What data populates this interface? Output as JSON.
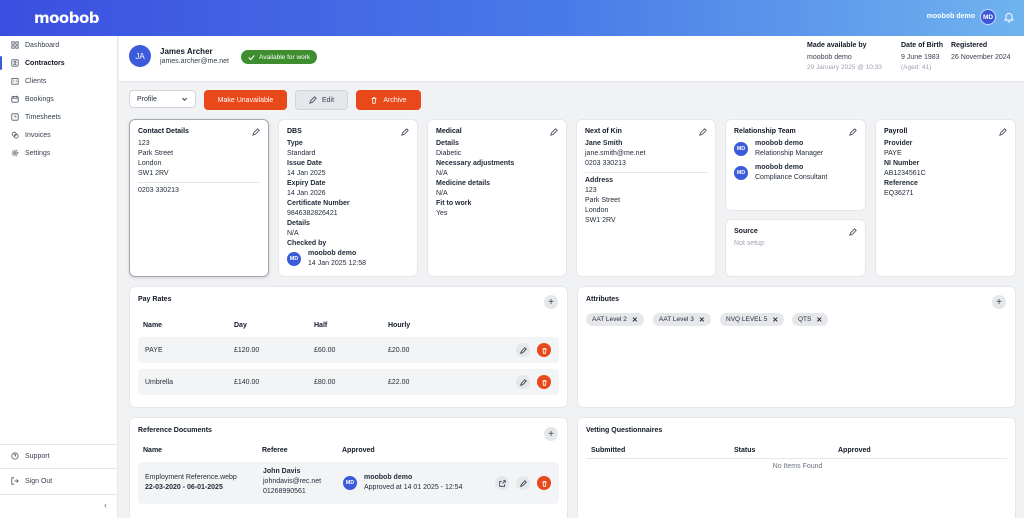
{
  "app": {
    "logo": "moobob",
    "user_name": "moobob demo",
    "user_initials": "MD"
  },
  "sidebar": {
    "items": [
      {
        "label": "Dashboard",
        "icon": "grid-icon"
      },
      {
        "label": "Contractors",
        "icon": "user-id-icon",
        "active": true
      },
      {
        "label": "Clients",
        "icon": "building-icon"
      },
      {
        "label": "Bookings",
        "icon": "calendar-icon"
      },
      {
        "label": "Timesheets",
        "icon": "clock-icon"
      },
      {
        "label": "Invoices",
        "icon": "coins-icon"
      },
      {
        "label": "Settings",
        "icon": "gear-icon"
      }
    ],
    "support": "Support",
    "sign_out": "Sign Out",
    "collapse": "‹"
  },
  "profile": {
    "initials": "JA",
    "name": "James Archer",
    "email": "james.archer@me.net",
    "status": "Available for work",
    "made_available_label": "Made available by",
    "made_available_by": "moobob demo",
    "made_available_at": "29 January 2025 @ 10:33",
    "dob_label": "Date of Birth",
    "dob": "9 June 1983",
    "age": "(Aged: 41)",
    "registered_label": "Registered",
    "registered": "26 November 2024"
  },
  "actions": {
    "select_value": "Profile",
    "make_unavailable": "Make Unavailable",
    "edit": "Edit",
    "archive": "Archive"
  },
  "contact": {
    "title": "Contact Details",
    "lines": [
      "123",
      "Park Street",
      "London",
      "SW1 2RV"
    ],
    "phone": "0203 330213"
  },
  "dbs": {
    "title": "DBS",
    "type_label": "Type",
    "type": "Standard",
    "issue_label": "Issue Date",
    "issue": "14 Jan 2025",
    "expiry_label": "Expiry Date",
    "expiry": "14 Jan 2026",
    "cert_label": "Certificate Number",
    "cert": "9846382826421",
    "details_label": "Details",
    "details": "N/A",
    "checked_label": "Checked by",
    "checked_initials": "MD",
    "checked_name": "moobob demo",
    "checked_at": "14 Jan 2025 12:58"
  },
  "medical": {
    "title": "Medical",
    "details_label": "Details",
    "details": "Diabetic",
    "adjust_label": "Necessary adjustments",
    "adjust": "N/A",
    "med_label": "Medicine details",
    "med": "N/A",
    "fit_label": "Fit to work",
    "fit": "Yes"
  },
  "kin": {
    "title": "Next of Kin",
    "name": "Jane Smith",
    "email": "jane.smith@me.net",
    "phone": "0203 330213",
    "address_label": "Address",
    "address": [
      "123",
      "Park Street",
      "London",
      "SW1 2RV"
    ]
  },
  "relationship": {
    "title": "Relationship Team",
    "members": [
      {
        "initials": "MD",
        "name": "moobob demo",
        "role": "Relationship Manager"
      },
      {
        "initials": "MD",
        "name": "moobob demo",
        "role": "Compliance Consultant"
      }
    ]
  },
  "source": {
    "title": "Source",
    "value": "Not setup"
  },
  "payroll": {
    "title": "Payroll",
    "provider_label": "Provider",
    "provider": "PAYE",
    "ni_label": "NI Number",
    "ni": "AB1234561C",
    "ref_label": "Reference",
    "ref": "EQ36271"
  },
  "pay_rates": {
    "title": "Pay Rates",
    "headers": [
      "Name",
      "Day",
      "Half",
      "Hourly"
    ],
    "rows": [
      {
        "name": "PAYE",
        "day": "£120.00",
        "half": "£60.00",
        "hourly": "£20.00"
      },
      {
        "name": "Umbrella",
        "day": "£140.00",
        "half": "£80.00",
        "hourly": "£22.00"
      }
    ]
  },
  "attributes": {
    "title": "Attributes",
    "chips": [
      "AAT Level 2",
      "AAT Level 3",
      "NVQ LEVEL 5",
      "QTS"
    ]
  },
  "references": {
    "title": "Reference Documents",
    "headers": [
      "Name",
      "Referee",
      "Approved"
    ],
    "rows": [
      {
        "doc": "Employment Reference.webp",
        "dates": "22-03-2020 - 06-01-2025",
        "referee": "John Davis",
        "referee_email": "johndavis@rec.net",
        "referee_phone": "01268990561",
        "approver_initials": "MD",
        "approver": "moobob demo",
        "approved_at": "Approved at 14 01 2025 - 12:54"
      }
    ]
  },
  "vetting": {
    "title": "Vetting Questionnaires",
    "headers": [
      "Submitted",
      "Status",
      "Approved"
    ],
    "empty": "No Items Found"
  }
}
